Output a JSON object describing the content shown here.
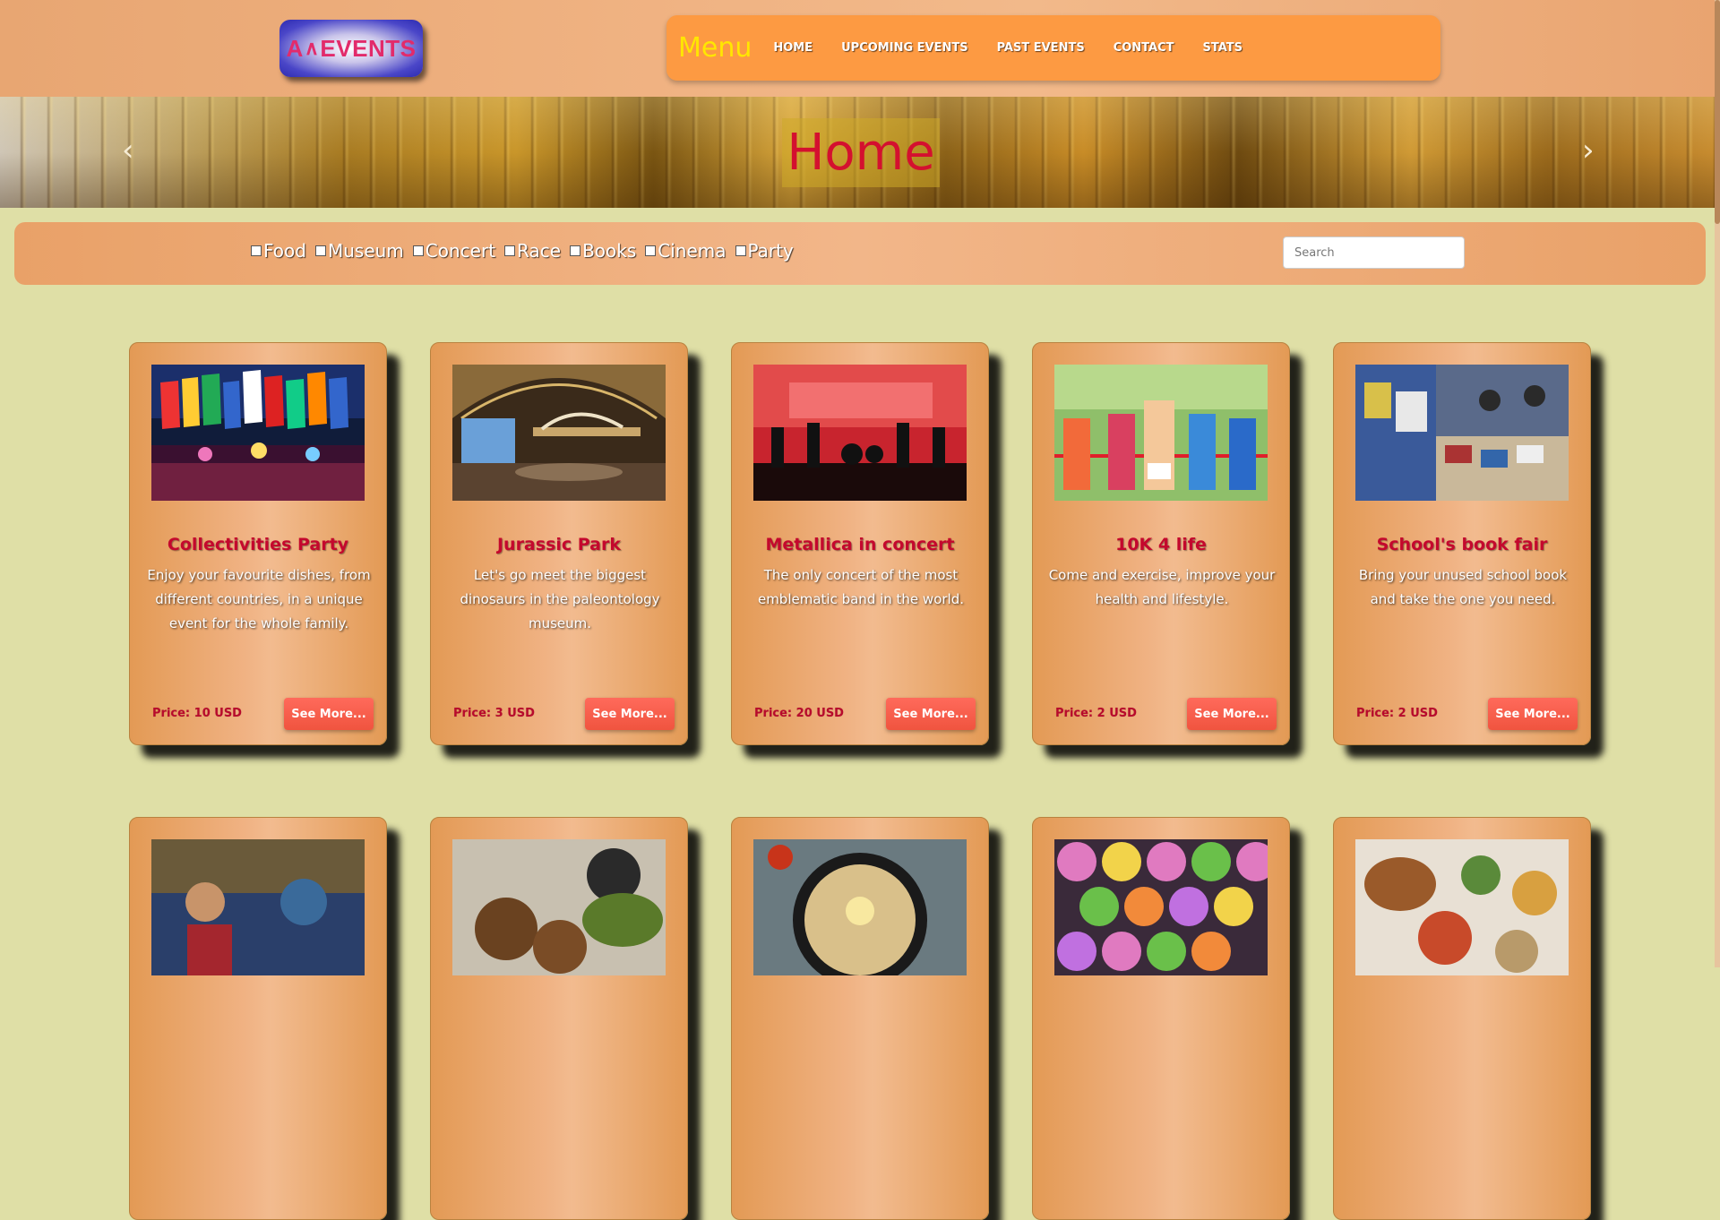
{
  "logo": {
    "a": "A",
    "mark": "∧",
    "events": "EVENTS"
  },
  "nav": {
    "title": "Menu",
    "links": [
      "HOME",
      "UPCOMING EVENTS",
      "PAST EVENTS",
      "CONTACT",
      "STATS"
    ]
  },
  "hero": {
    "title": "Home",
    "prev": "‹",
    "next": "›"
  },
  "filters": [
    "Food",
    "Museum",
    "Concert",
    "Race",
    "Books",
    "Cinema",
    "Party"
  ],
  "search": {
    "placeholder": "Search",
    "value": ""
  },
  "cards": [
    {
      "title": "Collectivities Party",
      "desc": "Enjoy your favourite dishes, from different countries, in a unique event for the whole family.",
      "price": "Price: 10 USD",
      "button": "See More...",
      "image": "party-flags-stage"
    },
    {
      "title": "Jurassic Park",
      "desc": "Let's go meet the biggest dinosaurs in the paleontology museum.",
      "price": "Price: 3 USD",
      "button": "See More...",
      "image": "dinosaur-museum-hall"
    },
    {
      "title": "Metallica in concert",
      "desc": "The only concert of the most emblematic band in the world.",
      "price": "Price: 20 USD",
      "button": "See More...",
      "image": "rock-concert-stage"
    },
    {
      "title": "10K 4 life",
      "desc": "Come and exercise, improve your health and lifestyle.",
      "price": "Price: 2 USD",
      "button": "See More...",
      "image": "runners-finish-line"
    },
    {
      "title": "School's book fair",
      "desc": "Bring your unused school book and take the one you need.",
      "price": "Price: 2 USD",
      "button": "See More...",
      "image": "book-fair-tables"
    }
  ],
  "cards_row2": [
    {
      "image": "movie-poster"
    },
    {
      "image": "falafel-dish"
    },
    {
      "image": "bibimbap-bowl"
    },
    {
      "image": "sushi-plates"
    },
    {
      "image": "mixed-dishes-table"
    }
  ],
  "colors": {
    "background": "#dfdfa6",
    "nav": "#fd9a42",
    "menu_title": "#ffe600",
    "hero_title": "#d4102f",
    "card_title": "#c4082d",
    "button": "#f0543f"
  }
}
